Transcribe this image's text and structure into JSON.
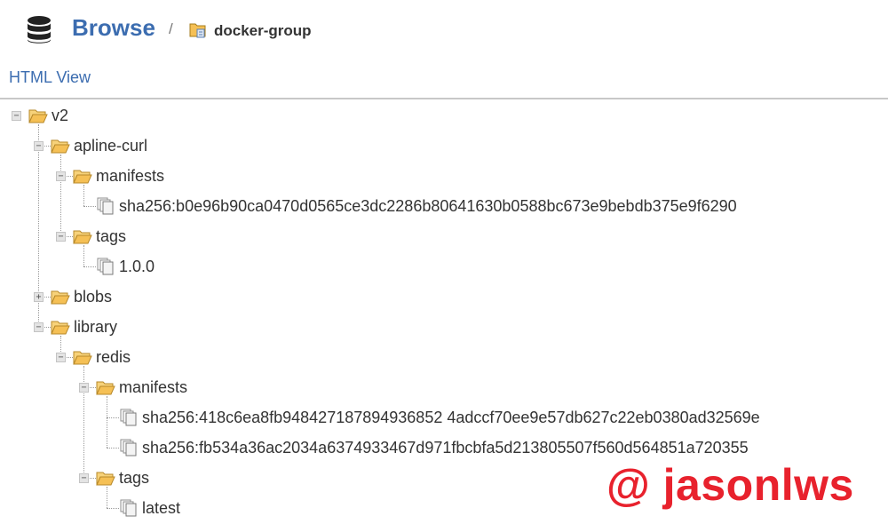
{
  "header": {
    "title": "Browse",
    "separator": "/",
    "repository": "docker-group"
  },
  "view_link": "HTML View",
  "tree": {
    "v2": "v2",
    "apline_curl": "apline-curl",
    "apline_manifests": "manifests",
    "apline_manifest_1": "sha256:b0e96b90ca0470d0565ce3dc2286b80641630b0588bc673e9bebdb375e9f6290",
    "apline_tags": "tags",
    "apline_tag_1": "1.0.0",
    "blobs": "blobs",
    "library": "library",
    "redis": "redis",
    "redis_manifests": "manifests",
    "redis_manifest_1": "sha256:418c6ea8fb948427187894936852 4adccf70ee9e57db627c22eb0380ad32569e",
    "redis_manifest_2": "sha256:fb534a36ac2034a6374933467d971fbcbfa5d213805507f560d564851a720355",
    "redis_tags": "tags",
    "redis_tag_1": "latest"
  },
  "toggles": {
    "collapse": "−",
    "expand": "+"
  },
  "watermark": "@ jasonlws",
  "colors": {
    "accent": "#3c6db0",
    "folder": "#f5c055",
    "watermark": "#e8222d"
  }
}
